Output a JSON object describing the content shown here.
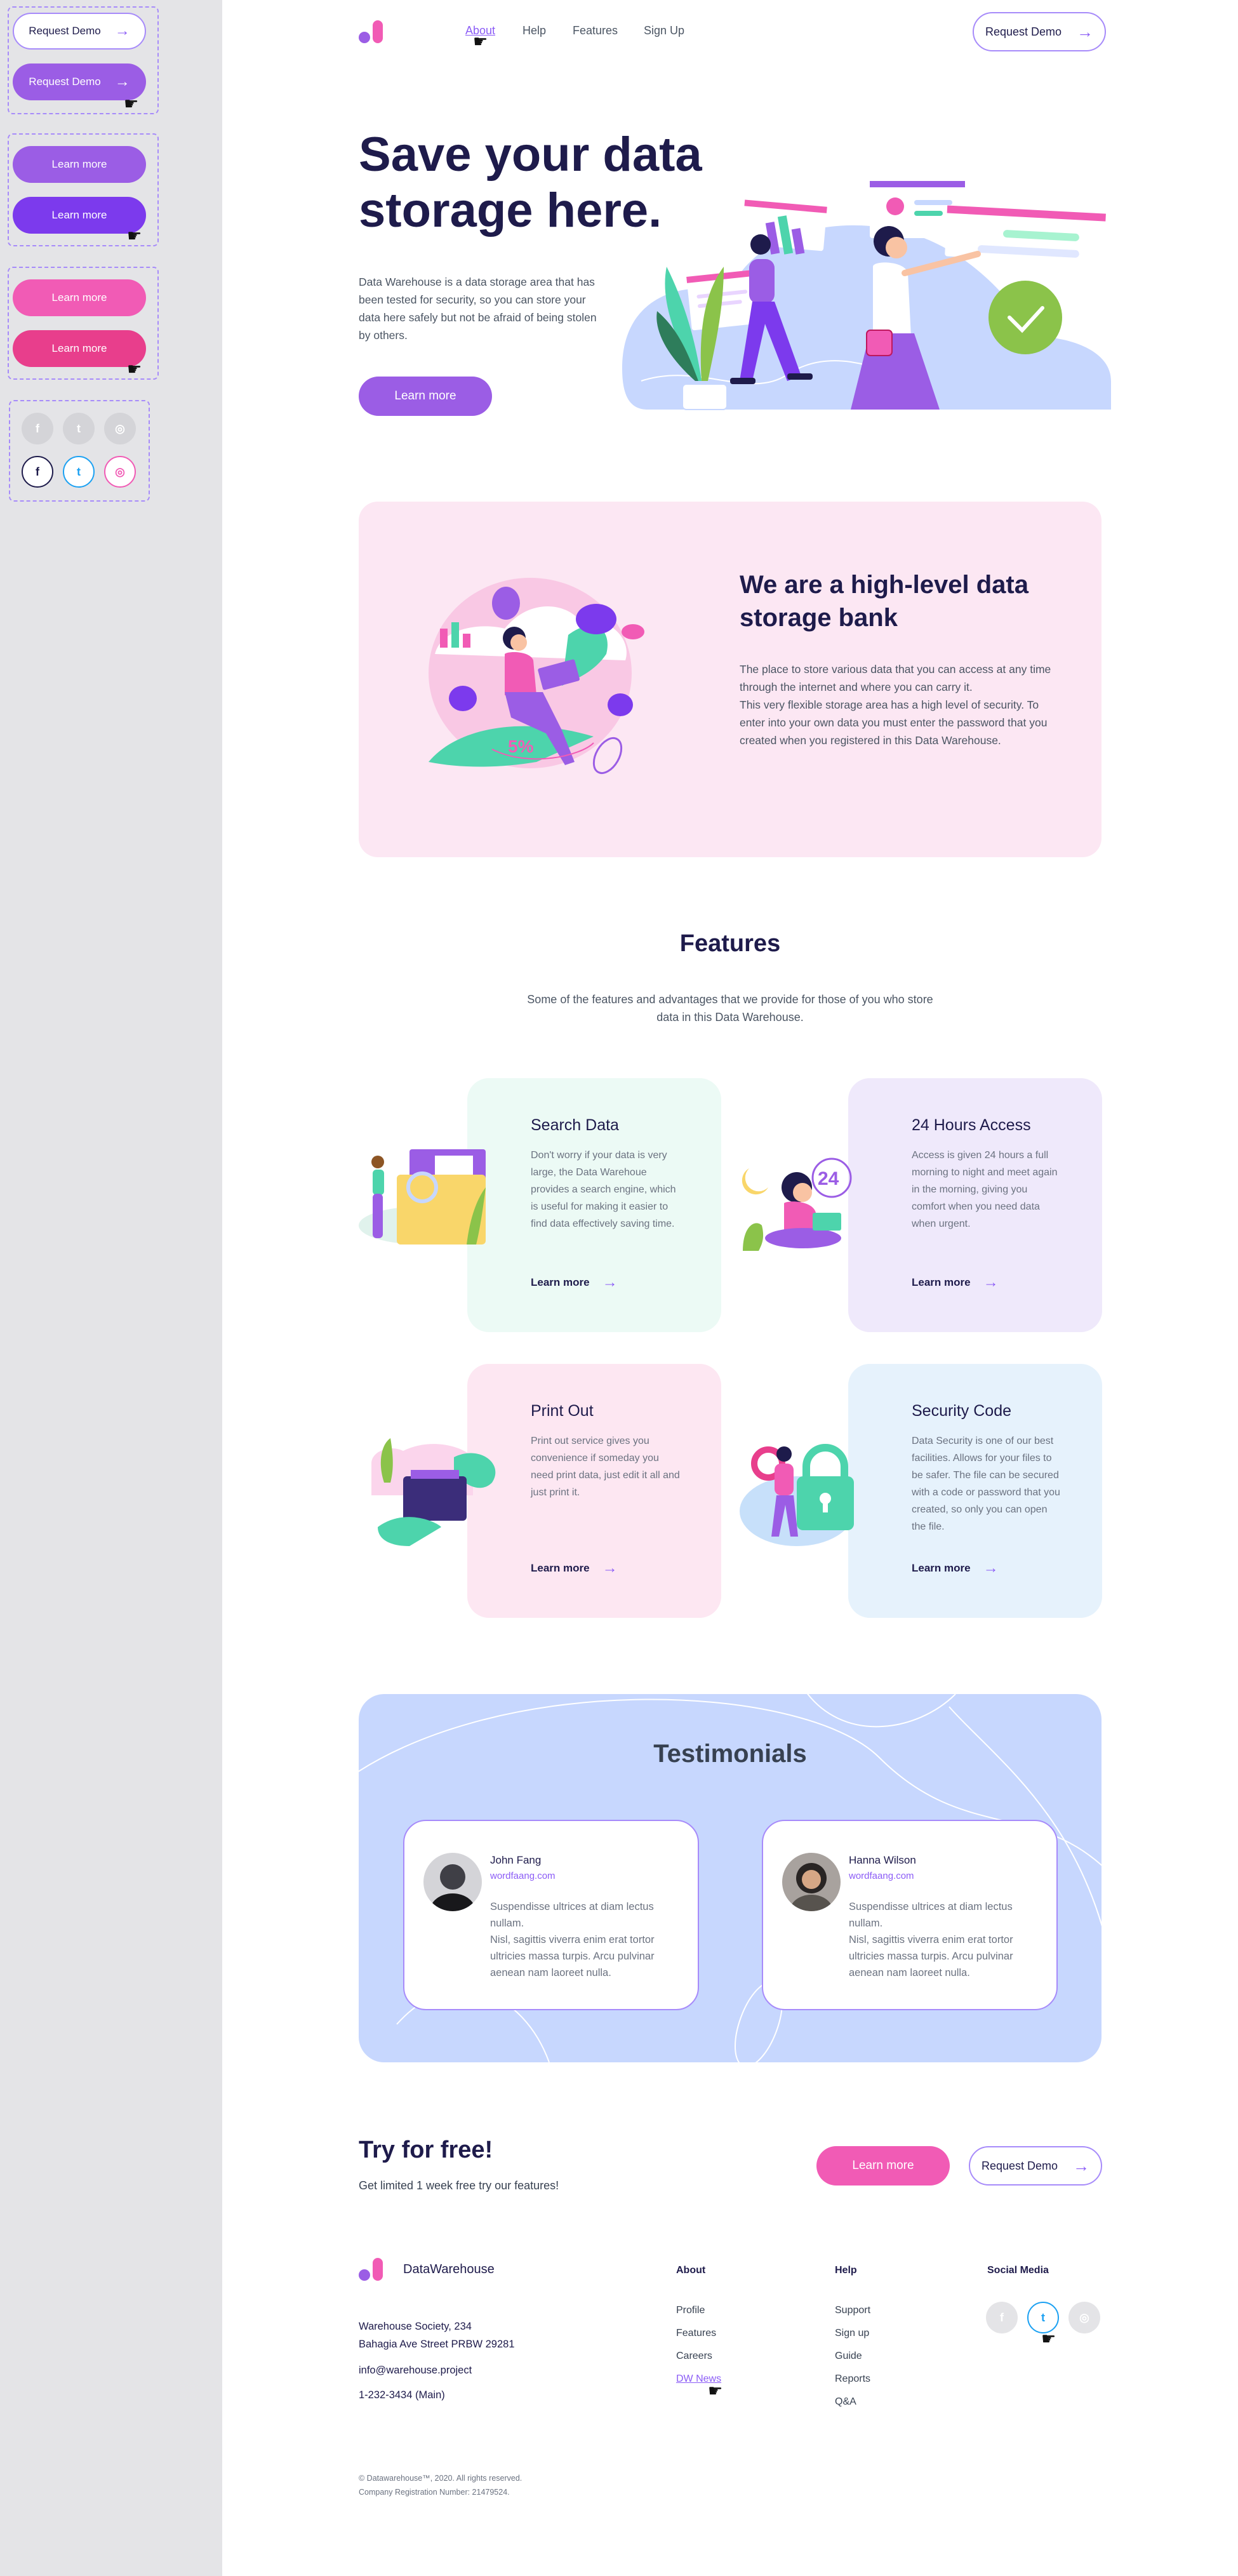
{
  "styleguide": {
    "request_demo": "Request Demo",
    "learn_more": "Learn more",
    "social_icons": [
      "f",
      "t",
      "ig"
    ]
  },
  "header": {
    "nav": [
      "About",
      "Help",
      "Features",
      "Sign Up"
    ],
    "active": "About",
    "cta": "Request Demo"
  },
  "hero": {
    "title": "Save your data storage here.",
    "text": "Data Warehouse is a data storage area that has been tested for security, so you can store your data here safely but not be afraid of being stolen by others.",
    "button": "Learn more"
  },
  "bank": {
    "title": "We are a high-level data storage bank",
    "text": "The place to store various data that you can access at any time through the internet  and where you can carry it.\nThis very flexible storage area has a high level of security. To enter into your own data you must enter the password that you created when you registered in this Data Warehouse."
  },
  "features": {
    "title": "Features",
    "subtitle": "Some of the features and advantages that we provide for those of you who store data in this Data Warehouse.",
    "link_label": "Learn more",
    "items": [
      {
        "title": "Search Data",
        "text": "Don't worry if your data is very large, the Data Warehoue provides a search engine, which is useful for making it easier to find data effectively saving time."
      },
      {
        "title": "24 Hours Access",
        "text": "Access is given 24 hours a full morning to night and meet again in the morning, giving you comfort when you need data when urgent."
      },
      {
        "title": "Print Out",
        "text": "Print out service gives you convenience if someday you need print data, just edit it all and just print it."
      },
      {
        "title": "Security Code",
        "text": "Data Security is one of our best facilities. Allows for your files to be safer. The file can be secured with a code or password that  you created, so only you can open the file."
      }
    ],
    "badge_24": "24"
  },
  "testimonials": {
    "title": "Testimonials",
    "items": [
      {
        "name": "John Fang",
        "handle": "wordfaang.com",
        "text": "Suspendisse ultrices at diam lectus nullam.\nNisl, sagittis viverra enim erat tortor ultricies massa turpis. Arcu pulvinar aenean nam laoreet nulla."
      },
      {
        "name": "Hanna Wilson",
        "handle": "wordfaang.com",
        "text": "Suspendisse ultrices at diam lectus nullam.\nNisl, sagittis viverra enim erat tortor ultricies massa turpis. Arcu pulvinar aenean nam laoreet nulla."
      }
    ]
  },
  "cta": {
    "title": "Try for free!",
    "subtitle": "Get limited 1 week free try our features!",
    "learn_more": "Learn more",
    "request_demo": "Request Demo"
  },
  "footer": {
    "brand": "DataWarehouse",
    "address1": "Warehouse Society, 234",
    "address2": "Bahagia Ave Street  PRBW 29281",
    "email": "info@warehouse.project",
    "phone": "1-232-3434 (Main)",
    "about_title": "About",
    "about_links": [
      "Profile",
      "Features",
      "Careers",
      "DW News"
    ],
    "help_title": "Help",
    "help_links": [
      "Support",
      "Sign up",
      "Guide",
      "Reports",
      "Q&A"
    ],
    "social_title": "Social Media",
    "copyright": "© Datawarehouse™, 2020. All rights reserved.",
    "company_reg": "Company Registration Number: 21479524."
  },
  "colors": {
    "primary": "#9b5de5",
    "primary_dark": "#7c3aed",
    "pink": "#f15bb5",
    "pink_dark": "#e83e8c",
    "navy": "#1e1b4b",
    "bank_bg": "#fce7f3",
    "testimonial_bg": "#c7d7fe"
  },
  "icons": [
    "cursor-hand-icon",
    "arrow-right-icon",
    "facebook-icon",
    "twitter-icon",
    "instagram-icon"
  ]
}
